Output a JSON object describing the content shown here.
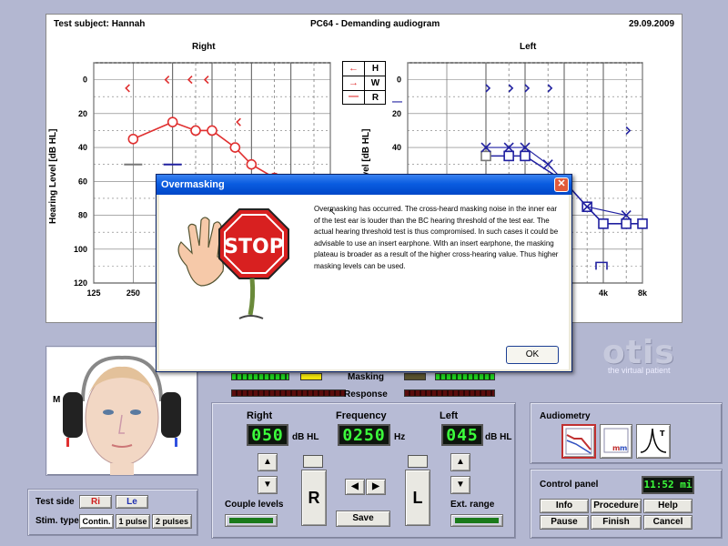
{
  "sheet": {
    "subject": "Test subject: Hannah",
    "title": "PC64 - Demanding audiogram",
    "date": "29.09.2009",
    "right_title": "Right",
    "left_title": "Left",
    "ylabel_right": "Hearing Level [dB HL]",
    "ylabel_left": "Hearing Level [dB HL]",
    "yticks": [
      "0",
      "20",
      "40",
      "60",
      "80",
      "100",
      "120"
    ],
    "xticks_right": [
      "125",
      "250"
    ],
    "xticks_left": [
      "4k",
      "8k"
    ]
  },
  "legend": {
    "h": "H",
    "w": "W",
    "r": "R"
  },
  "chart_data": [
    {
      "type": "line",
      "panel": "Right",
      "ylim": [
        0,
        120
      ],
      "y_inverted": true,
      "series": [
        {
          "marker": "circle",
          "color": "#e03030",
          "x": [
            250,
            500,
            750,
            1000,
            1500,
            2000,
            3000
          ],
          "y": [
            35,
            25,
            30,
            30,
            40,
            50,
            58
          ]
        }
      ],
      "bc_marks": {
        "color": "#e03030",
        "x": [
          250,
          500,
          750,
          1000,
          1500
        ],
        "y": [
          5,
          0,
          0,
          0,
          25
        ]
      }
    },
    {
      "type": "line",
      "panel": "Left",
      "ylim": [
        0,
        120
      ],
      "y_inverted": true,
      "series": [
        {
          "marker": "square",
          "color": "#2020a0",
          "x": [
            500,
            750,
            1000,
            2000,
            3000,
            4000,
            6000,
            8000
          ],
          "y": [
            45,
            45,
            45,
            60,
            75,
            85,
            85,
            85
          ]
        },
        {
          "marker": "x",
          "color": "#2020a0",
          "x": [
            500,
            750,
            1000,
            1500,
            2000,
            3000,
            6000
          ],
          "y": [
            40,
            40,
            40,
            50,
            60,
            75,
            80
          ]
        }
      ],
      "bc_marks": {
        "color": "#2020a0",
        "x": [
          500,
          750,
          1000,
          1500,
          6000
        ],
        "y": [
          5,
          5,
          5,
          5,
          30
        ]
      }
    }
  ],
  "dialog": {
    "title": "Overmasking",
    "close_glyph": "✕",
    "stop_text": "STOP",
    "message": "Overmasking has occurred. The cross-heard masking noise in the inner ear of the test ear is louder than the BC hearing threshold of the test ear. The actual hearing threshold test is thus compromised. In such cases it could be advisable to use an insert earphone. With an insert earphone, the masking plateau is broader as a result of the higher cross-hearing value. Thus higher masking levels can be used.",
    "ok_label": "OK"
  },
  "brand": {
    "logo": "otis",
    "tagline": "the virtual patient"
  },
  "head": {
    "marker": "M"
  },
  "meters": {
    "masking_label": "Masking",
    "response_label": "Response"
  },
  "controls": {
    "right_label": "Right",
    "frequency_label": "Frequency",
    "left_label": "Left",
    "right_value": "050",
    "right_unit": "dB HL",
    "frequency_value": "0250",
    "frequency_unit": "Hz",
    "left_value": "045",
    "left_unit": "dB HL",
    "couple_label": "Couple levels",
    "r_button": "R",
    "l_button": "L",
    "save_label": "Save",
    "ext_range_label": "Ext. range"
  },
  "test_side": {
    "label": "Test side",
    "ri": "Ri",
    "le": "Le",
    "stim_label": "Stim. type",
    "contin": "Contin.",
    "pulse1": "1 pulse",
    "pulse2": "2 pulses"
  },
  "audiometry": {
    "title": "Audiometry"
  },
  "control_panel": {
    "title": "Control panel",
    "clock": "11:52 mi",
    "info": "Info",
    "procedure": "Procedure",
    "help": "Help",
    "pause": "Pause",
    "finish": "Finish",
    "cancel": "Cancel"
  }
}
